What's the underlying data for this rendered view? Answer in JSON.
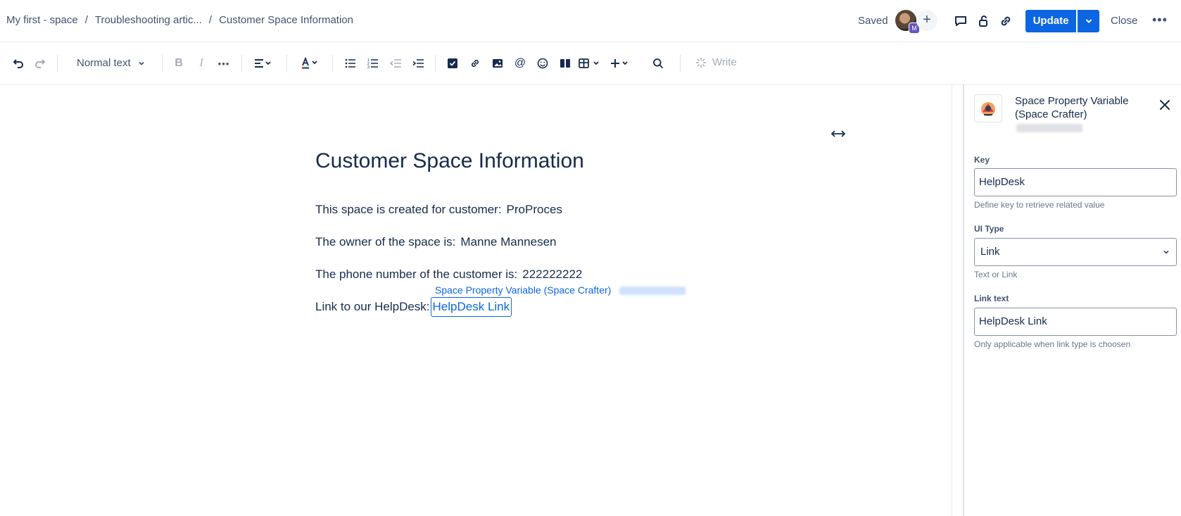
{
  "breadcrumb": {
    "items": [
      "My first - space",
      "Troubleshooting artic...",
      "Customer Space Information"
    ],
    "separator": "/"
  },
  "header": {
    "saved_label": "Saved",
    "avatar_badge": "M",
    "update_label": "Update",
    "close_label": "Close"
  },
  "toolbar": {
    "text_style": "Normal text",
    "write_label": "Write"
  },
  "page": {
    "title": "Customer Space Information",
    "lines": [
      {
        "label": "This space is created for customer:",
        "value": "ProProces"
      },
      {
        "label": "The owner of the space is:",
        "value": "Manne Mannesen"
      },
      {
        "label": "The phone number of the customer is:",
        "value": "222222222"
      },
      {
        "label": "Link to our HelpDesk:",
        "value": "HelpDesk Link"
      }
    ],
    "macro_label": "Space Property Variable (Space Crafter)"
  },
  "panel": {
    "title": "Space Property Variable (Space Crafter)",
    "fields": {
      "key": {
        "label": "Key",
        "value": "HelpDesk",
        "help": "Define key to retrieve related value"
      },
      "ui_type": {
        "label": "UI Type",
        "value": "Link",
        "help": "Text or Link"
      },
      "link_text": {
        "label": "Link text",
        "value": "HelpDesk Link",
        "help": "Only applicable when link type is choosen"
      }
    }
  },
  "colors": {
    "primary": "#0c66e4",
    "text": "#172b4d",
    "subtle": "#42526e"
  }
}
